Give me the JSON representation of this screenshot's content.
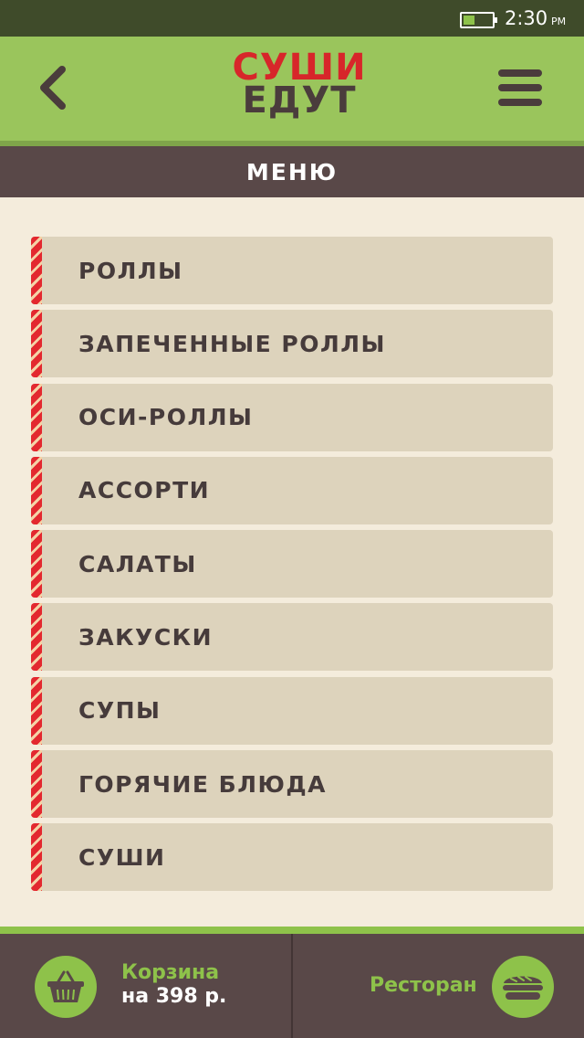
{
  "status_bar": {
    "time": "2:30",
    "ampm": "PM",
    "battery_icon": "battery-icon"
  },
  "header": {
    "logo_line1": "СУШИ",
    "logo_line2": "ЕДУТ",
    "back_icon": "chevron-left-icon",
    "menu_icon": "hamburger-menu-icon"
  },
  "section": {
    "title": "МЕНЮ"
  },
  "menu": {
    "items": [
      {
        "label": "РОЛЛЫ"
      },
      {
        "label": "ЗАПЕЧЕННЫЕ РОЛЛЫ"
      },
      {
        "label": "ОСИ-РОЛЛЫ"
      },
      {
        "label": "АССОРТИ"
      },
      {
        "label": "САЛАТЫ"
      },
      {
        "label": "ЗАКУСКИ"
      },
      {
        "label": "СУПЫ"
      },
      {
        "label": "ГОРЯЧИЕ БЛЮДА"
      },
      {
        "label": "СУШИ"
      }
    ]
  },
  "bottom": {
    "cart_title": "Корзина",
    "cart_amount": "на 398 р.",
    "restaurant_label": "Ресторан",
    "cart_icon": "basket-icon",
    "restaurant_icon": "sushi-icon"
  },
  "colors": {
    "status_bar": "#3f4b2a",
    "header_green": "#9ac55c",
    "section_brown": "#594848",
    "background_cream": "#f4ecdc",
    "item_bg": "#ddd3bc",
    "accent_red": "#e3282f",
    "accent_green": "#8ec24a"
  }
}
